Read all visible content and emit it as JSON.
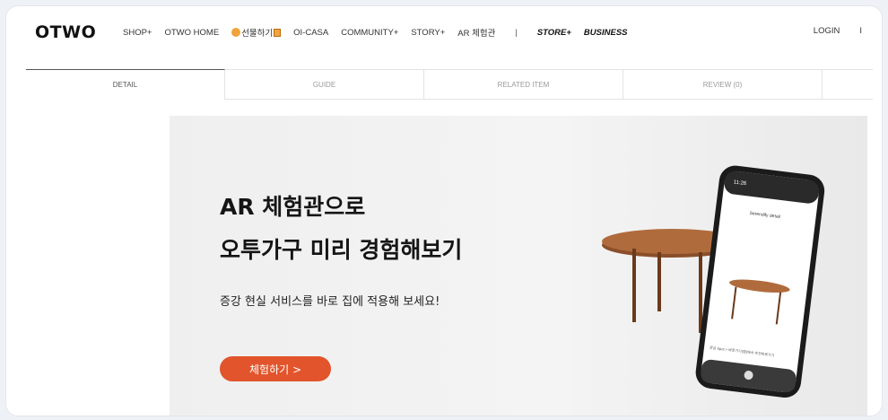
{
  "brand": {
    "logo": "OTWO"
  },
  "nav": {
    "items": [
      "SHOP+",
      "OTWO HOME"
    ],
    "gift": "선물하기",
    "items2": [
      "OI-CASA",
      "COMMUNITY+",
      "STORY+",
      "AR 체험관"
    ],
    "separator": "|",
    "store": "STORE+",
    "business": "BUSINESS",
    "login": "LOGIN",
    "truncated": "I"
  },
  "tabs": [
    "DETAIL",
    "GUIDE",
    "RELATED ITEM",
    "REVIEW (0)",
    ""
  ],
  "banner": {
    "title_line1": "AR 체험관으로",
    "title_line2": "오투가구 미리 경험해보기",
    "subtitle": "증강 현실 서비스를 바로 집에 적용해 보세요!",
    "cta": "체험하기 >"
  },
  "phone": {
    "time": "11:26",
    "title": "Serendify detail",
    "caption": "관심 Spot > 바로가기(앱)에서 추천바로가기"
  },
  "colors": {
    "accent": "#e2542b"
  }
}
